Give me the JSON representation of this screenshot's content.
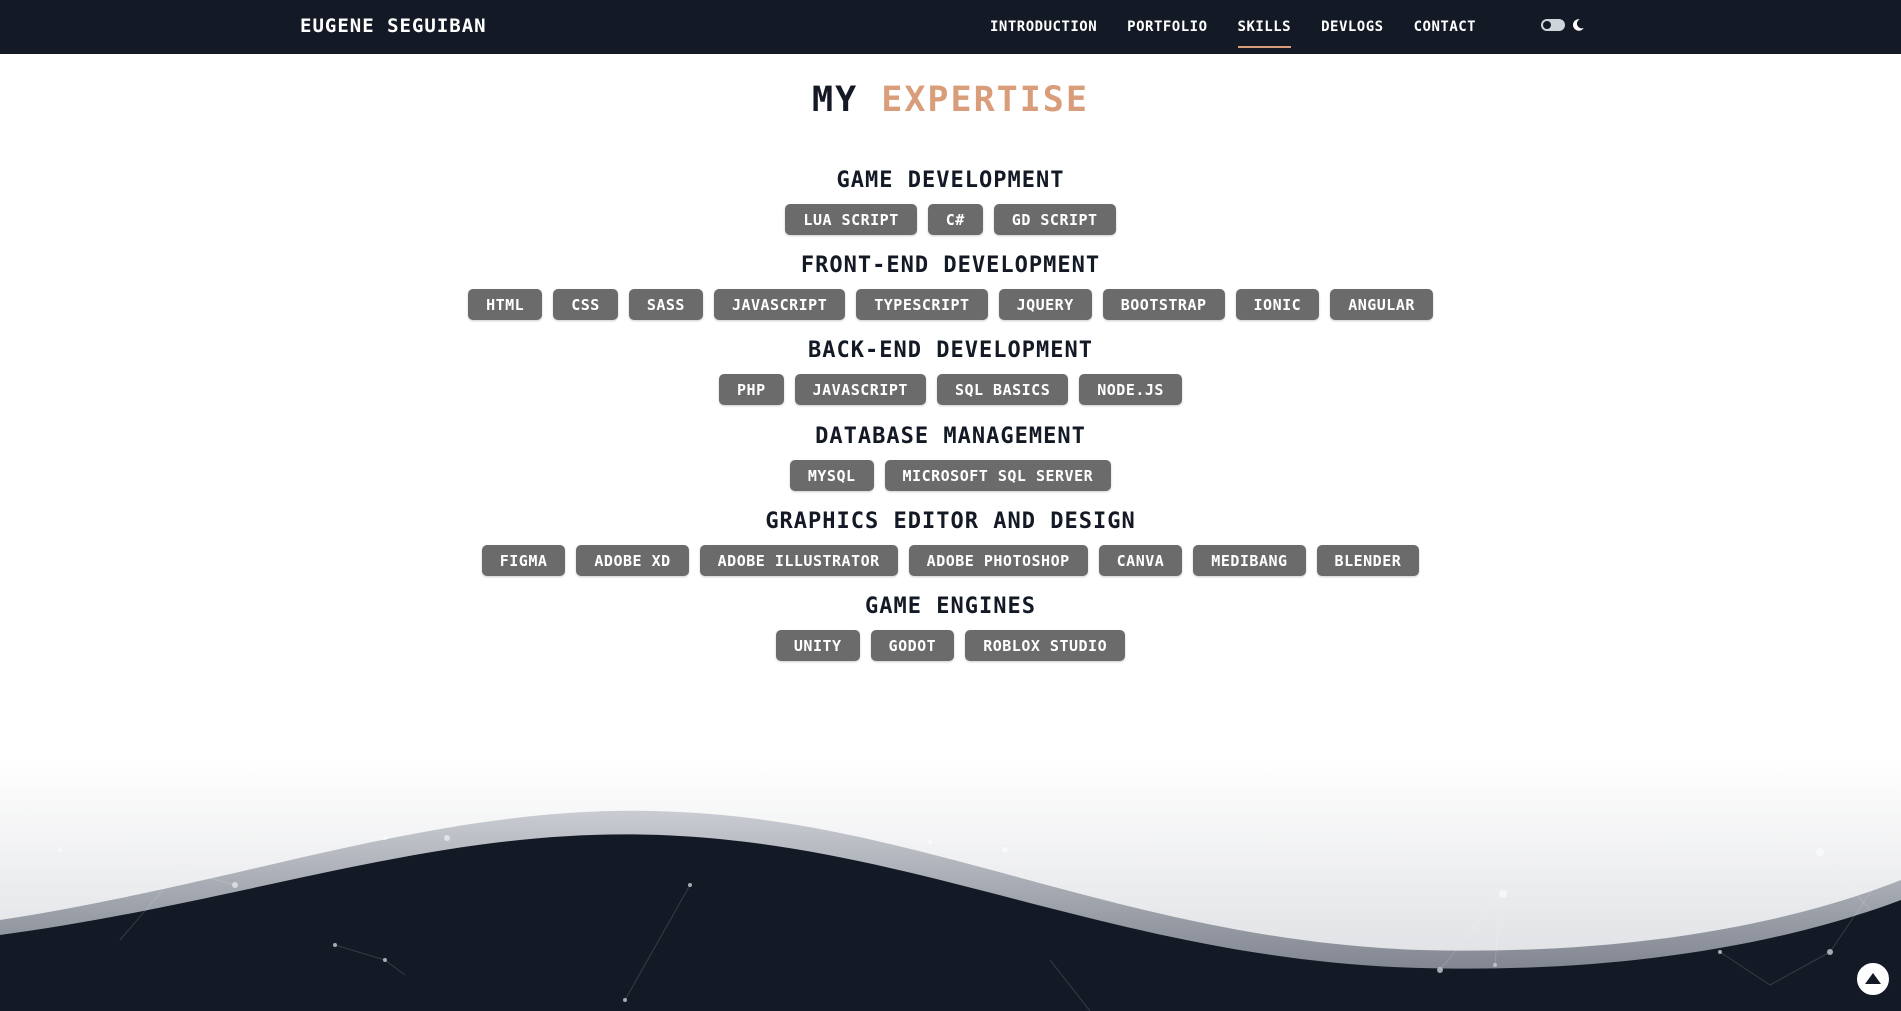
{
  "brand": "EUGENE SEGUIBAN",
  "nav": [
    {
      "label": "INTRODUCTION",
      "active": false
    },
    {
      "label": "PORTFOLIO",
      "active": false
    },
    {
      "label": "SKILLS",
      "active": true
    },
    {
      "label": "DEVLOGS",
      "active": false
    },
    {
      "label": "CONTACT",
      "active": false
    }
  ],
  "theme_toggle": {
    "icon": "moon-icon"
  },
  "title": {
    "prefix": "MY",
    "accent": "EXPERTISE"
  },
  "categories": [
    {
      "name": "GAME DEVELOPMENT",
      "skills": [
        "LUA SCRIPT",
        "C#",
        "GD SCRIPT"
      ]
    },
    {
      "name": "FRONT-END DEVELOPMENT",
      "skills": [
        "HTML",
        "CSS",
        "SASS",
        "JAVASCRIPT",
        "TYPESCRIPT",
        "JQUERY",
        "BOOTSTRAP",
        "IONIC",
        "ANGULAR"
      ]
    },
    {
      "name": "BACK-END DEVELOPMENT",
      "skills": [
        "PHP",
        "JAVASCRIPT",
        "SQL BASICS",
        "NODE.JS"
      ]
    },
    {
      "name": "DATABASE MANAGEMENT",
      "skills": [
        "MYSQL",
        "MICROSOFT SQL SERVER"
      ]
    },
    {
      "name": "GRAPHICS EDITOR AND DESIGN",
      "skills": [
        "FIGMA",
        "ADOBE XD",
        "ADOBE ILLUSTRATOR",
        "ADOBE PHOTOSHOP",
        "CANVA",
        "MEDIBANG",
        "BLENDER"
      ]
    },
    {
      "name": "GAME ENGINES",
      "skills": [
        "UNITY",
        "GODOT",
        "ROBLOX STUDIO"
      ]
    }
  ],
  "colors": {
    "navbar": "#141a25",
    "accent": "#d99d7a",
    "chip": "#6b6b6b"
  },
  "scroll_top": {
    "icon": "arrow-up-icon"
  }
}
